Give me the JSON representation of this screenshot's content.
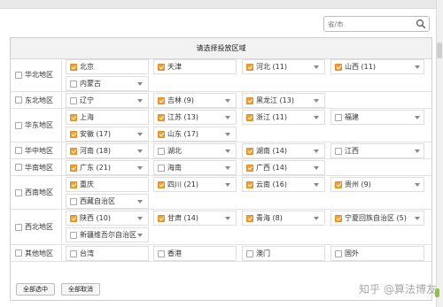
{
  "search": {
    "placeholder": "省/市"
  },
  "panel": {
    "title": "请选择投放区域"
  },
  "rows": [
    {
      "region": "华北地区",
      "checked": false,
      "items": [
        {
          "label": "北京",
          "checked": true,
          "dropdown": false
        },
        {
          "label": "天津",
          "checked": true,
          "dropdown": false
        },
        {
          "label": "河北 (11)",
          "checked": true,
          "dropdown": true
        },
        {
          "label": "山西 (11)",
          "checked": true,
          "dropdown": true
        },
        {
          "label": "内蒙古",
          "checked": false,
          "dropdown": true
        }
      ]
    },
    {
      "region": "东北地区",
      "checked": false,
      "items": [
        {
          "label": "辽宁",
          "checked": false,
          "dropdown": true
        },
        {
          "label": "吉林 (9)",
          "checked": true,
          "dropdown": true
        },
        {
          "label": "黑龙江 (13)",
          "checked": true,
          "dropdown": true
        }
      ]
    },
    {
      "region": "华东地区",
      "checked": false,
      "items": [
        {
          "label": "上海",
          "checked": true,
          "dropdown": false
        },
        {
          "label": "江苏 (13)",
          "checked": true,
          "dropdown": true
        },
        {
          "label": "浙江 (11)",
          "checked": true,
          "dropdown": true
        },
        {
          "label": "福建",
          "checked": false,
          "dropdown": true
        },
        {
          "label": "安徽 (17)",
          "checked": true,
          "dropdown": true
        },
        {
          "label": "山东 (17)",
          "checked": true,
          "dropdown": true
        }
      ]
    },
    {
      "region": "华中地区",
      "checked": false,
      "items": [
        {
          "label": "河南 (18)",
          "checked": true,
          "dropdown": true
        },
        {
          "label": "湖北",
          "checked": false,
          "dropdown": true
        },
        {
          "label": "湖南 (14)",
          "checked": true,
          "dropdown": true
        },
        {
          "label": "江西",
          "checked": false,
          "dropdown": true
        }
      ]
    },
    {
      "region": "华南地区",
      "checked": false,
      "items": [
        {
          "label": "广东 (21)",
          "checked": true,
          "dropdown": true
        },
        {
          "label": "海南",
          "checked": false,
          "dropdown": true
        },
        {
          "label": "广西 (14)",
          "checked": true,
          "dropdown": true
        }
      ]
    },
    {
      "region": "西南地区",
      "checked": false,
      "items": [
        {
          "label": "重庆",
          "checked": true,
          "dropdown": false
        },
        {
          "label": "四川 (21)",
          "checked": true,
          "dropdown": true
        },
        {
          "label": "云南 (16)",
          "checked": true,
          "dropdown": true
        },
        {
          "label": "贵州 (9)",
          "checked": true,
          "dropdown": true
        },
        {
          "label": "西藏自治区",
          "checked": false,
          "dropdown": true
        }
      ]
    },
    {
      "region": "西北地区",
      "checked": false,
      "items": [
        {
          "label": "陕西 (10)",
          "checked": true,
          "dropdown": true
        },
        {
          "label": "甘肃 (14)",
          "checked": true,
          "dropdown": true
        },
        {
          "label": "青海 (8)",
          "checked": true,
          "dropdown": true
        },
        {
          "label": "宁夏回族自治区 (5)",
          "checked": true,
          "dropdown": true
        },
        {
          "label": "新疆维吾尔自治区",
          "checked": false,
          "dropdown": true
        }
      ]
    },
    {
      "region": "其他地区",
      "checked": false,
      "items": [
        {
          "label": "台湾",
          "checked": false,
          "dropdown": false
        },
        {
          "label": "香港",
          "checked": false,
          "dropdown": false
        },
        {
          "label": "澳门",
          "checked": false,
          "dropdown": false
        },
        {
          "label": "国外",
          "checked": false,
          "dropdown": false
        }
      ]
    }
  ],
  "buttons": {
    "select_all": "全部选中",
    "cancel_all": "全部取消"
  },
  "watermark": "知乎 @算法博友",
  "colors": {
    "checkbox_checked": "#f0a030",
    "header_bg": "#f2f2f2",
    "border": "#dedede"
  }
}
